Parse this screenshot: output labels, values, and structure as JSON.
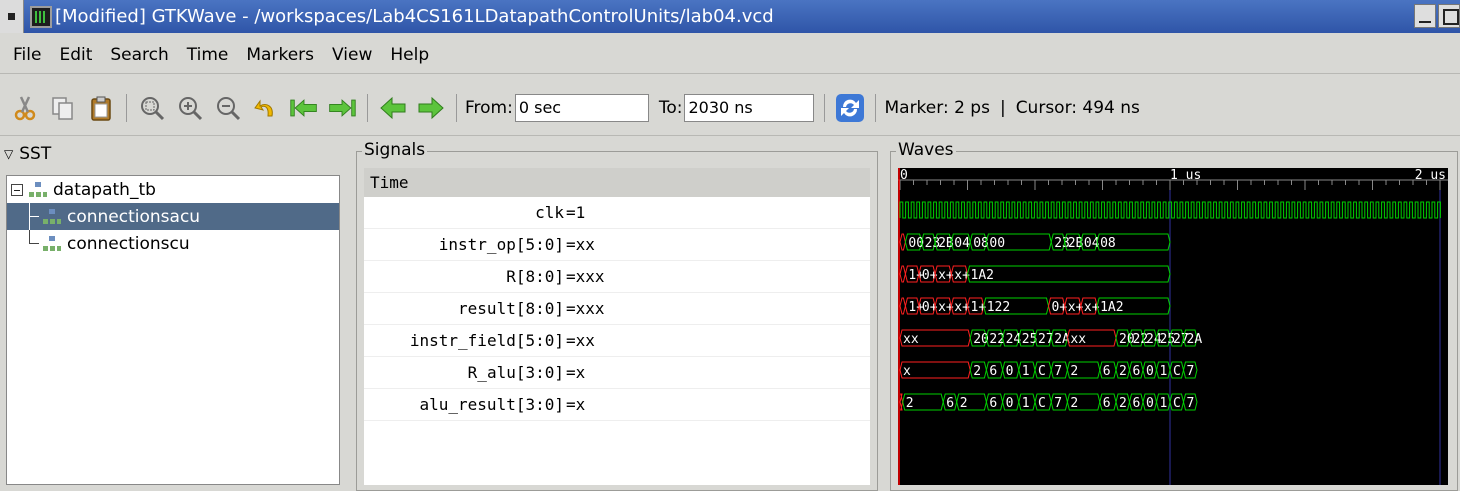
{
  "window": {
    "title": "[Modified] GTKWave - /workspaces/Lab4CS161LDatapathControlUnits/lab04.vcd"
  },
  "menu": [
    "File",
    "Edit",
    "Search",
    "Time",
    "Markers",
    "View",
    "Help"
  ],
  "toolbar": {
    "icons": [
      "cut-icon",
      "copy-icon",
      "paste-icon",
      "zoom-fit-icon",
      "zoom-in-icon",
      "zoom-out-icon",
      "undo-zoom-icon",
      "zoom-start-icon",
      "zoom-end-icon",
      "find-prev-edge-icon",
      "find-next-edge-icon",
      "reload-icon"
    ],
    "from_label": "From:",
    "from_value": "0 sec",
    "to_label": "To:",
    "to_value": "2030 ns",
    "marker_text": "Marker: 2 ps",
    "separator": "|",
    "cursor_text": "Cursor: 494 ns"
  },
  "sst": {
    "label": "SST",
    "tree": [
      {
        "label": "datapath_tb",
        "level": 0
      },
      {
        "label": "connectionsacu",
        "level": 1,
        "selected": true
      },
      {
        "label": "connectionscu",
        "level": 1
      }
    ]
  },
  "signals": {
    "label": "Signals",
    "header": "Time",
    "rows": [
      {
        "name": "clk",
        "value": "=1"
      },
      {
        "name": "instr_op[5:0]",
        "value": "=xx"
      },
      {
        "name": "R[8:0]",
        "value": "=xxx"
      },
      {
        "name": "result[8:0]",
        "value": "=xxx"
      },
      {
        "name": "instr_field[5:0]",
        "value": "=xx"
      },
      {
        "name": "R_alu[3:0]",
        "value": "=x"
      },
      {
        "name": "alu_result[3:0]",
        "value": "=x"
      }
    ]
  },
  "waves": {
    "label": "Waves",
    "timeline_labels": [
      "0",
      "1 us",
      "2 us"
    ],
    "colors": {
      "valid": "#00d000",
      "unknown": "#ff2020",
      "cursor": "#ffffff",
      "marker": "#ff0000",
      "grid": "#3232a0",
      "text": "#ffffff"
    },
    "traces": [
      {
        "segments": [
          {
            "t": 0,
            "text": "",
            "x": true
          },
          {
            "t": 0.02,
            "text": "00"
          },
          {
            "t": 0.08,
            "text": "23"
          },
          {
            "t": 0.13,
            "text": "2B"
          },
          {
            "t": 0.19,
            "text": "04"
          },
          {
            "t": 0.26,
            "text": "08"
          },
          {
            "t": 0.32,
            "text": "00"
          },
          {
            "t": 0.56,
            "text": "23"
          },
          {
            "t": 0.61,
            "text": "2B"
          },
          {
            "t": 0.67,
            "text": "04"
          },
          {
            "t": 0.73,
            "text": "08"
          }
        ],
        "end": 1.0
      },
      {
        "segments": [
          {
            "t": 0,
            "text": "",
            "x": true
          },
          {
            "t": 0.02,
            "text": "1+",
            "x": true
          },
          {
            "t": 0.07,
            "text": "0+",
            "x": true
          },
          {
            "t": 0.13,
            "text": "x+",
            "x": true
          },
          {
            "t": 0.19,
            "text": "x+",
            "x": true
          },
          {
            "t": 0.25,
            "text": "1A2"
          }
        ],
        "end": 1.0
      },
      {
        "segments": [
          {
            "t": 0,
            "text": "",
            "x": true
          },
          {
            "t": 0.02,
            "text": "1+",
            "x": true
          },
          {
            "t": 0.07,
            "text": "0+",
            "x": true
          },
          {
            "t": 0.13,
            "text": "x+",
            "x": true
          },
          {
            "t": 0.19,
            "text": "x+",
            "x": true
          },
          {
            "t": 0.25,
            "text": "1+",
            "x": true
          },
          {
            "t": 0.31,
            "text": "122"
          },
          {
            "t": 0.55,
            "text": "0+",
            "x": true
          },
          {
            "t": 0.61,
            "text": "x+",
            "x": true
          },
          {
            "t": 0.67,
            "text": "x+",
            "x": true
          },
          {
            "t": 0.73,
            "text": "1A2"
          }
        ],
        "end": 1.0
      },
      {
        "segments": [
          {
            "t": 0,
            "text": "xx",
            "x": true
          },
          {
            "t": 0.26,
            "text": "20"
          },
          {
            "t": 0.32,
            "text": "22"
          },
          {
            "t": 0.38,
            "text": "24"
          },
          {
            "t": 0.44,
            "text": "25"
          },
          {
            "t": 0.5,
            "text": "27"
          },
          {
            "t": 0.56,
            "text": "2A"
          },
          {
            "t": 0.62,
            "text": "xx",
            "x": true
          },
          {
            "t": 0.8,
            "text": "20"
          },
          {
            "t": 0.85,
            "text": "22"
          },
          {
            "t": 0.9,
            "text": "24"
          },
          {
            "t": 0.95,
            "text": "25"
          },
          {
            "t": 1.0,
            "text": "27"
          },
          {
            "t": 1.05,
            "text": "2A"
          }
        ],
        "end": 1.1
      },
      {
        "segments": [
          {
            "t": 0,
            "text": "x",
            "x": true
          },
          {
            "t": 0.26,
            "text": "2"
          },
          {
            "t": 0.32,
            "text": "6"
          },
          {
            "t": 0.38,
            "text": "0"
          },
          {
            "t": 0.44,
            "text": "1"
          },
          {
            "t": 0.5,
            "text": "C"
          },
          {
            "t": 0.56,
            "text": "7"
          },
          {
            "t": 0.62,
            "text": "2"
          },
          {
            "t": 0.74,
            "text": "6"
          },
          {
            "t": 0.8,
            "text": "2"
          },
          {
            "t": 0.85,
            "text": "6"
          },
          {
            "t": 0.9,
            "text": "0"
          },
          {
            "t": 0.95,
            "text": "1"
          },
          {
            "t": 1.0,
            "text": "C"
          },
          {
            "t": 1.05,
            "text": "7"
          }
        ],
        "end": 1.1
      },
      {
        "segments": [
          {
            "t": 0,
            "text": "",
            "x": true
          },
          {
            "t": 0.01,
            "text": "2"
          },
          {
            "t": 0.16,
            "text": "6"
          },
          {
            "t": 0.21,
            "text": "2"
          },
          {
            "t": 0.32,
            "text": "6"
          },
          {
            "t": 0.38,
            "text": "0"
          },
          {
            "t": 0.44,
            "text": "1"
          },
          {
            "t": 0.5,
            "text": "C"
          },
          {
            "t": 0.56,
            "text": "7"
          },
          {
            "t": 0.62,
            "text": "2"
          },
          {
            "t": 0.74,
            "text": "6"
          },
          {
            "t": 0.8,
            "text": "2"
          },
          {
            "t": 0.85,
            "text": "6"
          },
          {
            "t": 0.9,
            "text": "0"
          },
          {
            "t": 0.95,
            "text": "1"
          },
          {
            "t": 1.0,
            "text": "C"
          },
          {
            "t": 1.05,
            "text": "7"
          }
        ],
        "end": 1.1
      }
    ]
  }
}
